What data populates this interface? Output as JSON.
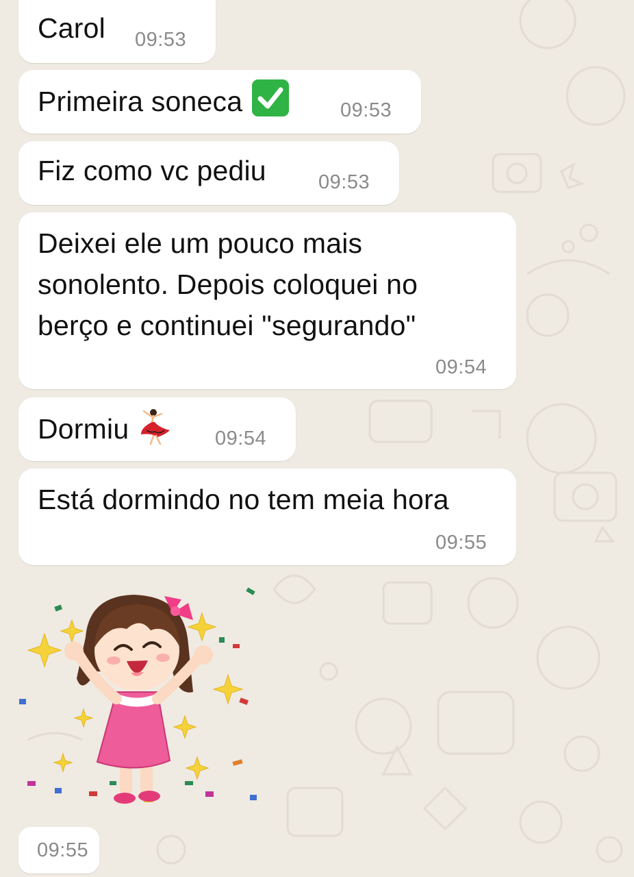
{
  "messages": [
    {
      "text": "Carol",
      "time": "09:53"
    },
    {
      "text": "Primeira soneca",
      "emoji": "white-check-mark",
      "time": "09:53"
    },
    {
      "text": "Fiz como vc pediu",
      "time": "09:53"
    },
    {
      "lines": [
        "Deixei ele um pouco mais",
        "sonolento. Depois coloquei no",
        "berço e continuei \"segurando\""
      ],
      "time": "09:54"
    },
    {
      "text": "Dormiu",
      "emoji": "dancer",
      "time": "09:54"
    },
    {
      "text": "Está dormindo no tem meia hora",
      "time": "09:55"
    }
  ],
  "sticker": {
    "description_icon": "celebrating-girl-sticker",
    "time": "09:55"
  },
  "colors": {
    "chat_background": "#efeae2",
    "bubble": "#ffffff",
    "timestamp": "#8a8a8a",
    "check": "#2fb344"
  }
}
